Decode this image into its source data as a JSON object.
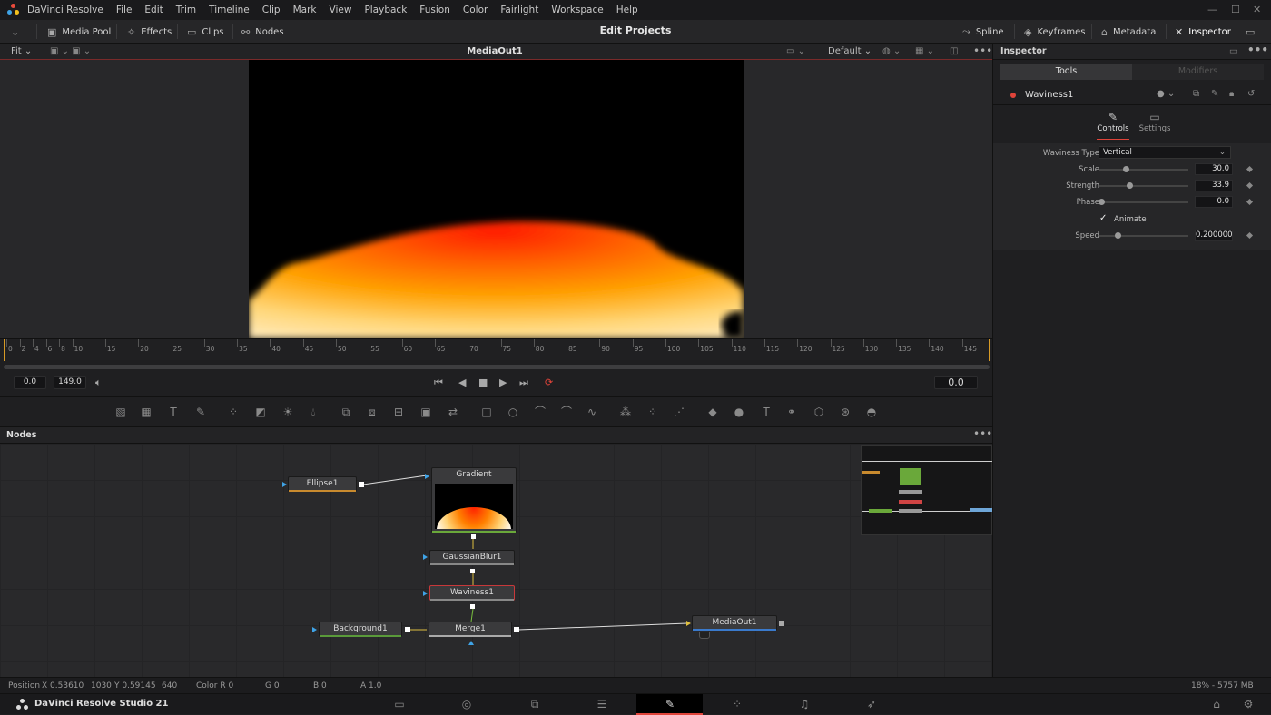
{
  "app": {
    "name": "DaVinci Resolve",
    "studio_label": "DaVinci Resolve Studio 21"
  },
  "menu": [
    "DaVinci Resolve",
    "File",
    "Edit",
    "Trim",
    "Timeline",
    "Clip",
    "Mark",
    "View",
    "Playback",
    "Fusion",
    "Color",
    "Fairlight",
    "Workspace",
    "Help"
  ],
  "toolbar": {
    "media_pool": "Media Pool",
    "effects": "Effects",
    "clips": "Clips",
    "nodes": "Nodes",
    "page_title": "Edit Projects",
    "spline": "Spline",
    "keyframes": "Keyframes",
    "metadata": "Metadata",
    "inspector": "Inspector"
  },
  "viewer": {
    "fit": "Fit",
    "name": "MediaOut1",
    "lut": "Default"
  },
  "ruler": {
    "ticks": [
      "0",
      "2",
      "4",
      "6",
      "8",
      "10",
      "15",
      "20",
      "25",
      "30",
      "35",
      "40",
      "45",
      "50",
      "55",
      "60",
      "65",
      "70",
      "75",
      "80",
      "85",
      "90",
      "95",
      "100",
      "105",
      "110",
      "115",
      "120",
      "125",
      "130",
      "135",
      "140",
      "145"
    ]
  },
  "transport": {
    "start": "0.0",
    "end": "149.0",
    "current": "0.0"
  },
  "nodes_panel": {
    "title": "Nodes"
  },
  "nodes": {
    "ellipse": "Ellipse1",
    "gradient": "Gradient",
    "blur": "GaussianBlur1",
    "waviness": "Waviness1",
    "background": "Background1",
    "merge": "Merge1",
    "mediaout": "MediaOut1"
  },
  "status": {
    "position_label": "Position",
    "x": "X 0.53610",
    "x_px": "1030",
    "y": "Y 0.59145",
    "y_px": "640",
    "color_r": "Color R 0",
    "g": "G 0",
    "b": "B 0",
    "a": "A 1.0",
    "mem": "18% - 5757 MB"
  },
  "inspector": {
    "title": "Inspector",
    "tab_tools": "Tools",
    "tab_modifiers": "Modifiers",
    "tool_name": "Waviness1",
    "sub_controls": "Controls",
    "sub_settings": "Settings",
    "type_label": "Waviness Type",
    "type_value": "Vertical",
    "scale_label": "Scale",
    "scale_value": "30.0",
    "strength_label": "Strength",
    "strength_value": "33.9",
    "phase_label": "Phase",
    "phase_value": "0.0",
    "animate_label": "Animate",
    "speed_label": "Speed",
    "speed_value": "0.200000"
  }
}
